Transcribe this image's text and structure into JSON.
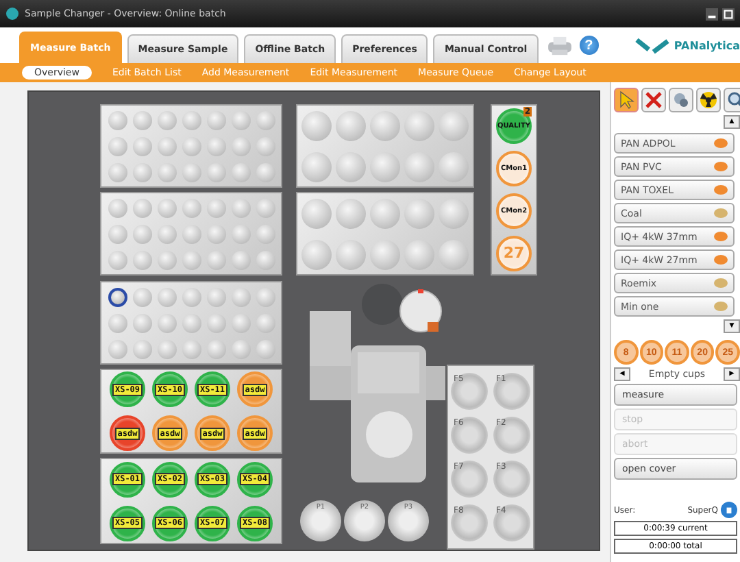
{
  "window": {
    "title": "Sample Changer - Overview: Online batch"
  },
  "tabs": [
    {
      "label": "Measure Batch",
      "selected": true
    },
    {
      "label": "Measure Sample",
      "selected": false
    },
    {
      "label": "Offline Batch",
      "selected": false
    },
    {
      "label": "Preferences",
      "selected": false
    },
    {
      "label": "Manual Control",
      "selected": false
    }
  ],
  "help_button": "?",
  "logo": {
    "text": "PANalytica"
  },
  "subnav": [
    {
      "label": "Overview",
      "selected": true
    },
    {
      "label": "Edit Batch List",
      "selected": false
    },
    {
      "label": "Add Measurement",
      "selected": false
    },
    {
      "label": "Edit Measurement",
      "selected": false
    },
    {
      "label": "Measure Queue",
      "selected": false
    },
    {
      "label": "Change Layout",
      "selected": false
    }
  ],
  "trays": [
    {
      "kind": "small",
      "first_selected": false
    },
    {
      "kind": "small",
      "first_selected": false
    },
    {
      "kind": "small",
      "first_selected": true
    },
    {
      "kind": "loaded",
      "cups": [
        {
          "label": "XS-09",
          "color": "#2fb34a"
        },
        {
          "label": "XS-10",
          "color": "#2fb34a"
        },
        {
          "label": "XS-11",
          "color": "#2fb34a"
        },
        {
          "label": "asdw",
          "color": "#f0963c"
        },
        {
          "label": "asdw",
          "color": "#e8442a"
        },
        {
          "label": "asdw",
          "color": "#f0963c"
        },
        {
          "label": "asdw",
          "color": "#f0963c"
        },
        {
          "label": "asdw",
          "color": "#f0963c"
        }
      ]
    },
    {
      "kind": "loaded",
      "cups": [
        {
          "label": "XS-01",
          "color": "#2fb34a"
        },
        {
          "label": "XS-02",
          "color": "#2fb34a"
        },
        {
          "label": "XS-03",
          "color": "#2fb34a"
        },
        {
          "label": "XS-04",
          "color": "#2fb34a"
        },
        {
          "label": "XS-05",
          "color": "#2fb34a"
        },
        {
          "label": "XS-06",
          "color": "#2fb34a"
        },
        {
          "label": "XS-07",
          "color": "#2fb34a"
        },
        {
          "label": "XS-08",
          "color": "#2fb34a"
        }
      ]
    },
    {
      "kind": "medium"
    },
    {
      "kind": "medium"
    }
  ],
  "standards": [
    {
      "kind": "tag",
      "label": "QUALITY",
      "badge": "2",
      "color": "#2fb34a"
    },
    {
      "kind": "tag",
      "label": "CMon1",
      "color": "#f0963c"
    },
    {
      "kind": "tag",
      "label": "CMon2",
      "color": "#f0963c"
    },
    {
      "kind": "number",
      "label": "27",
      "color": "#f0963c"
    }
  ],
  "positions_f": [
    "F5",
    "F1",
    "F6",
    "F2",
    "F7",
    "F3",
    "F8",
    "F4"
  ],
  "positions_p": [
    "P1",
    "P2",
    "P3"
  ],
  "tools": [
    {
      "kind": "pointer",
      "selected": true
    },
    {
      "kind": "delete",
      "selected": false
    },
    {
      "kind": "copy",
      "selected": false
    },
    {
      "kind": "radiation",
      "selected": false
    },
    {
      "kind": "search",
      "selected": false
    }
  ],
  "scroll_up": "▲",
  "applications": [
    {
      "name": "PAN ADPOL",
      "color": "#f08a30"
    },
    {
      "name": "PAN PVC",
      "color": "#f08a30"
    },
    {
      "name": "PAN TOXEL",
      "color": "#f08a30"
    },
    {
      "name": "Coal",
      "color": "#d6b46e"
    },
    {
      "name": "IQ+ 4kW 37mm",
      "color": "#f08a30"
    },
    {
      "name": "IQ+ 4kW 27mm",
      "color": "#f08a30"
    },
    {
      "name": "Roemix",
      "color": "#d6b46e"
    },
    {
      "name": "Min one",
      "color": "#d6b46e"
    }
  ],
  "scroll_down": "▼",
  "empty_cups": {
    "numbers": [
      "8",
      "10",
      "11",
      "20",
      "25"
    ],
    "prev": "◄",
    "label": "Empty cups",
    "next": "►"
  },
  "actions": [
    {
      "label": "measure",
      "disabled": false
    },
    {
      "label": "stop",
      "disabled": true
    },
    {
      "label": "abort",
      "disabled": true
    },
    {
      "label": "open cover",
      "disabled": false
    }
  ],
  "user": {
    "label": "User:",
    "name": "SuperQ"
  },
  "timers": [
    "0:00:39 current",
    "0:00:00 total"
  ]
}
